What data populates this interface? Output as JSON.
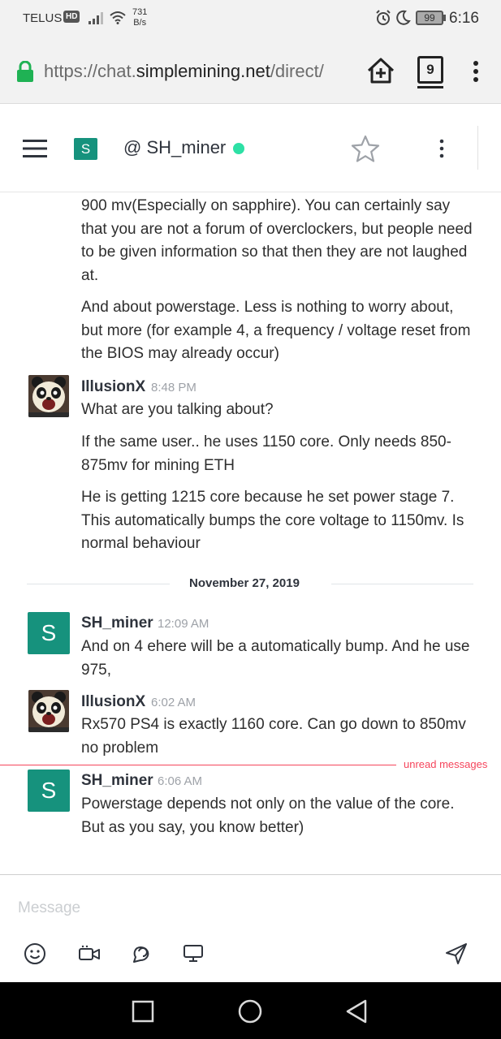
{
  "status_bar": {
    "carrier": "TELUS",
    "network_badge": "HD",
    "speed_value": "731",
    "speed_unit": "B/s",
    "battery": "99",
    "time": "6:16",
    "icons": [
      "signal-icon",
      "wifi-icon",
      "alarm-icon",
      "moon-icon",
      "battery-icon"
    ]
  },
  "browser": {
    "url_prefix": "https://chat.",
    "url_host": "simplemining.net",
    "url_suffix": "/direct/",
    "tab_count": "9",
    "accent": "#1fb254"
  },
  "room": {
    "avatar_letter": "S",
    "title": "@ SH_miner",
    "online_color": "#2de0a5",
    "avatar_color": "#16927d"
  },
  "messages": {
    "m0_p1": "900 mv(Especially on sapphire). You can certainly say that you are not a forum of overclockers, but people need to be given information so that then they are not laughed at.",
    "m0_p2": "And about powerstage. Less is nothing to worry about, but more (for example 4, a frequency / voltage reset from the BIOS may already occur)",
    "m1": {
      "user": "IllusionX",
      "time": "8:48 PM",
      "p1": "What are you talking about?",
      "p2": "If the same user.. he uses 1150 core. Only needs 850-875mv for mining ETH",
      "p3": "He is getting 1215 core because he set power stage 7. This automatically bumps the core voltage to 1150mv. Is normal behaviour"
    },
    "day_divider": "November 27, 2019",
    "m2": {
      "avatar_letter": "S",
      "user": "SH_miner",
      "time": "12:09 AM",
      "p1": "And on 4 ehere will be a automatically bump. And he use 975,"
    },
    "m3": {
      "user": "IllusionX",
      "time": "6:02 AM",
      "p1": "Rx570 PS4 is exactly 1160 core. Can go down to 850mv no problem"
    },
    "unread_label": "unread messages",
    "m4": {
      "avatar_letter": "S",
      "user": "SH_miner",
      "time": "6:06 AM",
      "p1": "Powerstage depends not only on the value of the core. But as you say, you know better)"
    }
  },
  "composer": {
    "placeholder": "Message",
    "icons": [
      "emoji-icon",
      "video-icon",
      "discussion-icon",
      "screen-share-icon",
      "send-icon"
    ]
  },
  "navbar": {
    "icons": [
      "recents-icon",
      "home-icon",
      "back-icon"
    ]
  }
}
